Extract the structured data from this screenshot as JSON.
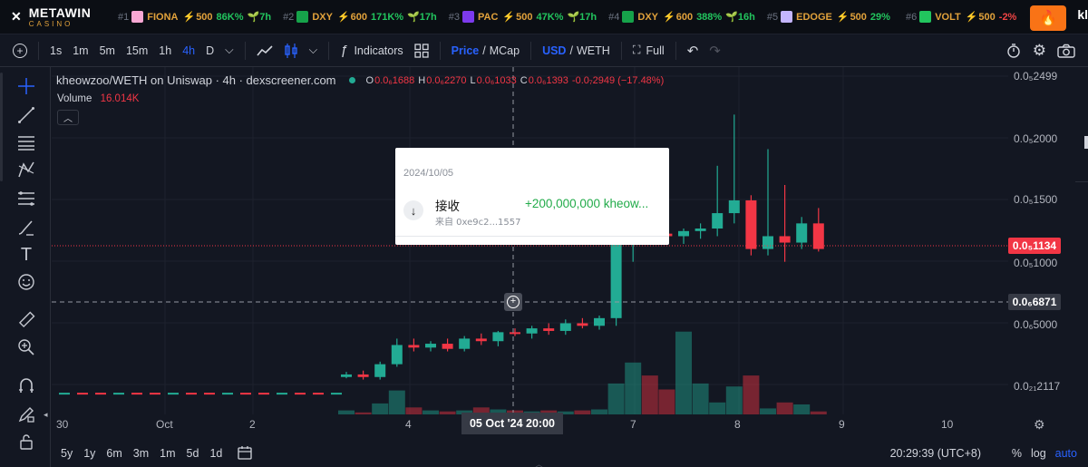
{
  "ticker": {
    "brand": "METAWIN",
    "brand_sub": "CASINO",
    "items": [
      {
        "rank": "#1",
        "symbol": "FIONA",
        "score": "500",
        "change": "86K%",
        "age": "7h",
        "icon_color": "#f9a8d4",
        "negative": false
      },
      {
        "rank": "#2",
        "symbol": "DXY",
        "score": "600",
        "change": "171K%",
        "age": "17h",
        "icon_color": "#16a34a",
        "negative": false
      },
      {
        "rank": "#3",
        "symbol": "PAC",
        "score": "500",
        "change": "47K%",
        "age": "17h",
        "icon_color": "#7c3aed",
        "negative": false
      },
      {
        "rank": "#4",
        "symbol": "DXY",
        "score": "600",
        "change": "388%",
        "age": "16h",
        "icon_color": "#16a34a",
        "negative": false
      },
      {
        "rank": "#5",
        "symbol": "EDOGE",
        "score": "500",
        "change": "29%",
        "age": "",
        "icon_color": "#c4b5fd",
        "negative": false
      },
      {
        "rank": "#6",
        "symbol": "VOLT",
        "score": "500",
        "change": "-2%",
        "age": "",
        "icon_color": "#22c55e",
        "negative": true
      }
    ],
    "cut_text": "kl"
  },
  "toolbar": {
    "intervals": [
      "1s",
      "1m",
      "5m",
      "15m",
      "1h",
      "4h",
      "D"
    ],
    "active_interval": "4h",
    "indicators_label": "Indicators",
    "price_label": "Price",
    "mcap_label": "MCap",
    "usd_label": "USD",
    "weth_label": "WETH",
    "full_label": "Full"
  },
  "legend": {
    "title": "kheowzoo/WETH on Uniswap · 4h · dexscreener.com",
    "o_label": "O",
    "o_value": "0.0₆1688",
    "h_label": "H",
    "h_value": "0.0₆2270",
    "l_label": "L",
    "l_value": "0.0₆1033",
    "c_label": "C",
    "c_value": "0.0₆1393",
    "change": "-0.0₇2949 (−17.48%)",
    "volume_label": "Volume",
    "volume_value": "16.014K"
  },
  "price_axis": {
    "labels": [
      "0.0₅2499",
      "0.0₅2000",
      "0.0₅1500",
      "0.0₅1000",
      "0.0₆5000",
      "0.0₂₁2117"
    ],
    "last_price": "0.0₅1134",
    "crosshair_price": "0.0₆6871"
  },
  "time_axis": {
    "labels": [
      "30",
      "Oct",
      "2",
      "4",
      "7",
      "8",
      "9",
      "10"
    ],
    "crosshair_time": "05 Oct '24   20:00"
  },
  "popup": {
    "date": "2024/10/05",
    "type": "接收",
    "from": "来自 0xe9c2...1557",
    "amount": "+200,000,000 kheow..."
  },
  "bottom": {
    "ranges": [
      "5y",
      "1y",
      "6m",
      "3m",
      "1m",
      "5d",
      "1d"
    ],
    "clock": "20:29:39 (UTC+8)",
    "pct_label": "%",
    "log_label": "log",
    "auto_label": "auto"
  },
  "colors": {
    "up": "#22ab94",
    "down": "#f23645",
    "accent": "#2962ff"
  },
  "chart_data": {
    "type": "candlestick",
    "note_scale": "price in WETH ×1e-6",
    "candles": [
      {
        "o": 0.2,
        "h": 0.24,
        "l": 0.19,
        "c": 0.22
      },
      {
        "o": 0.22,
        "h": 0.25,
        "l": 0.18,
        "c": 0.2
      },
      {
        "o": 0.2,
        "h": 0.32,
        "l": 0.18,
        "c": 0.3
      },
      {
        "o": 0.3,
        "h": 0.5,
        "l": 0.28,
        "c": 0.45
      },
      {
        "o": 0.45,
        "h": 0.5,
        "l": 0.4,
        "c": 0.43
      },
      {
        "o": 0.43,
        "h": 0.48,
        "l": 0.4,
        "c": 0.46
      },
      {
        "o": 0.46,
        "h": 0.5,
        "l": 0.4,
        "c": 0.42
      },
      {
        "o": 0.42,
        "h": 0.52,
        "l": 0.4,
        "c": 0.5
      },
      {
        "o": 0.5,
        "h": 0.54,
        "l": 0.45,
        "c": 0.48
      },
      {
        "o": 0.48,
        "h": 0.56,
        "l": 0.44,
        "c": 0.55
      },
      {
        "o": 0.55,
        "h": 0.58,
        "l": 0.52,
        "c": 0.54
      },
      {
        "o": 0.54,
        "h": 0.6,
        "l": 0.5,
        "c": 0.58
      },
      {
        "o": 0.58,
        "h": 0.62,
        "l": 0.53,
        "c": 0.56
      },
      {
        "o": 0.56,
        "h": 0.65,
        "l": 0.53,
        "c": 0.62
      },
      {
        "o": 0.62,
        "h": 0.66,
        "l": 0.58,
        "c": 0.6
      },
      {
        "o": 0.6,
        "h": 0.68,
        "l": 0.57,
        "c": 0.66
      },
      {
        "o": 0.66,
        "h": 1.35,
        "l": 0.6,
        "c": 1.25
      },
      {
        "o": 1.25,
        "h": 1.45,
        "l": 1.1,
        "c": 1.35
      },
      {
        "o": 1.35,
        "h": 1.38,
        "l": 1.28,
        "c": 1.32
      },
      {
        "o": 1.32,
        "h": 1.36,
        "l": 1.26,
        "c": 1.3
      },
      {
        "o": 1.3,
        "h": 1.36,
        "l": 1.24,
        "c": 1.34
      },
      {
        "o": 1.34,
        "h": 1.4,
        "l": 1.28,
        "c": 1.36
      },
      {
        "o": 1.36,
        "h": 1.85,
        "l": 1.3,
        "c": 1.48
      },
      {
        "o": 1.48,
        "h": 2.25,
        "l": 1.4,
        "c": 1.58
      },
      {
        "o": 1.58,
        "h": 1.62,
        "l": 1.15,
        "c": 1.2
      },
      {
        "o": 1.2,
        "h": 1.98,
        "l": 1.15,
        "c": 1.3
      },
      {
        "o": 1.3,
        "h": 1.7,
        "l": 1.1,
        "c": 1.25
      },
      {
        "o": 1.25,
        "h": 1.45,
        "l": 1.2,
        "c": 1.4
      },
      {
        "o": 1.4,
        "h": 1.52,
        "l": 1.18,
        "c": 1.2
      }
    ],
    "volumes": [
      0.4,
      0.2,
      1.1,
      2.4,
      0.7,
      0.4,
      0.3,
      0.4,
      0.7,
      0.5,
      0.4,
      0.3,
      0.4,
      0.3,
      0.4,
      0.5,
      3.1,
      5.2,
      3.9,
      2.5,
      8.3,
      3.1,
      1.2,
      2.8,
      3.9,
      0.6,
      1.2,
      1.0,
      0.3
    ],
    "ylim": [
      0.0,
      2.55
    ]
  }
}
